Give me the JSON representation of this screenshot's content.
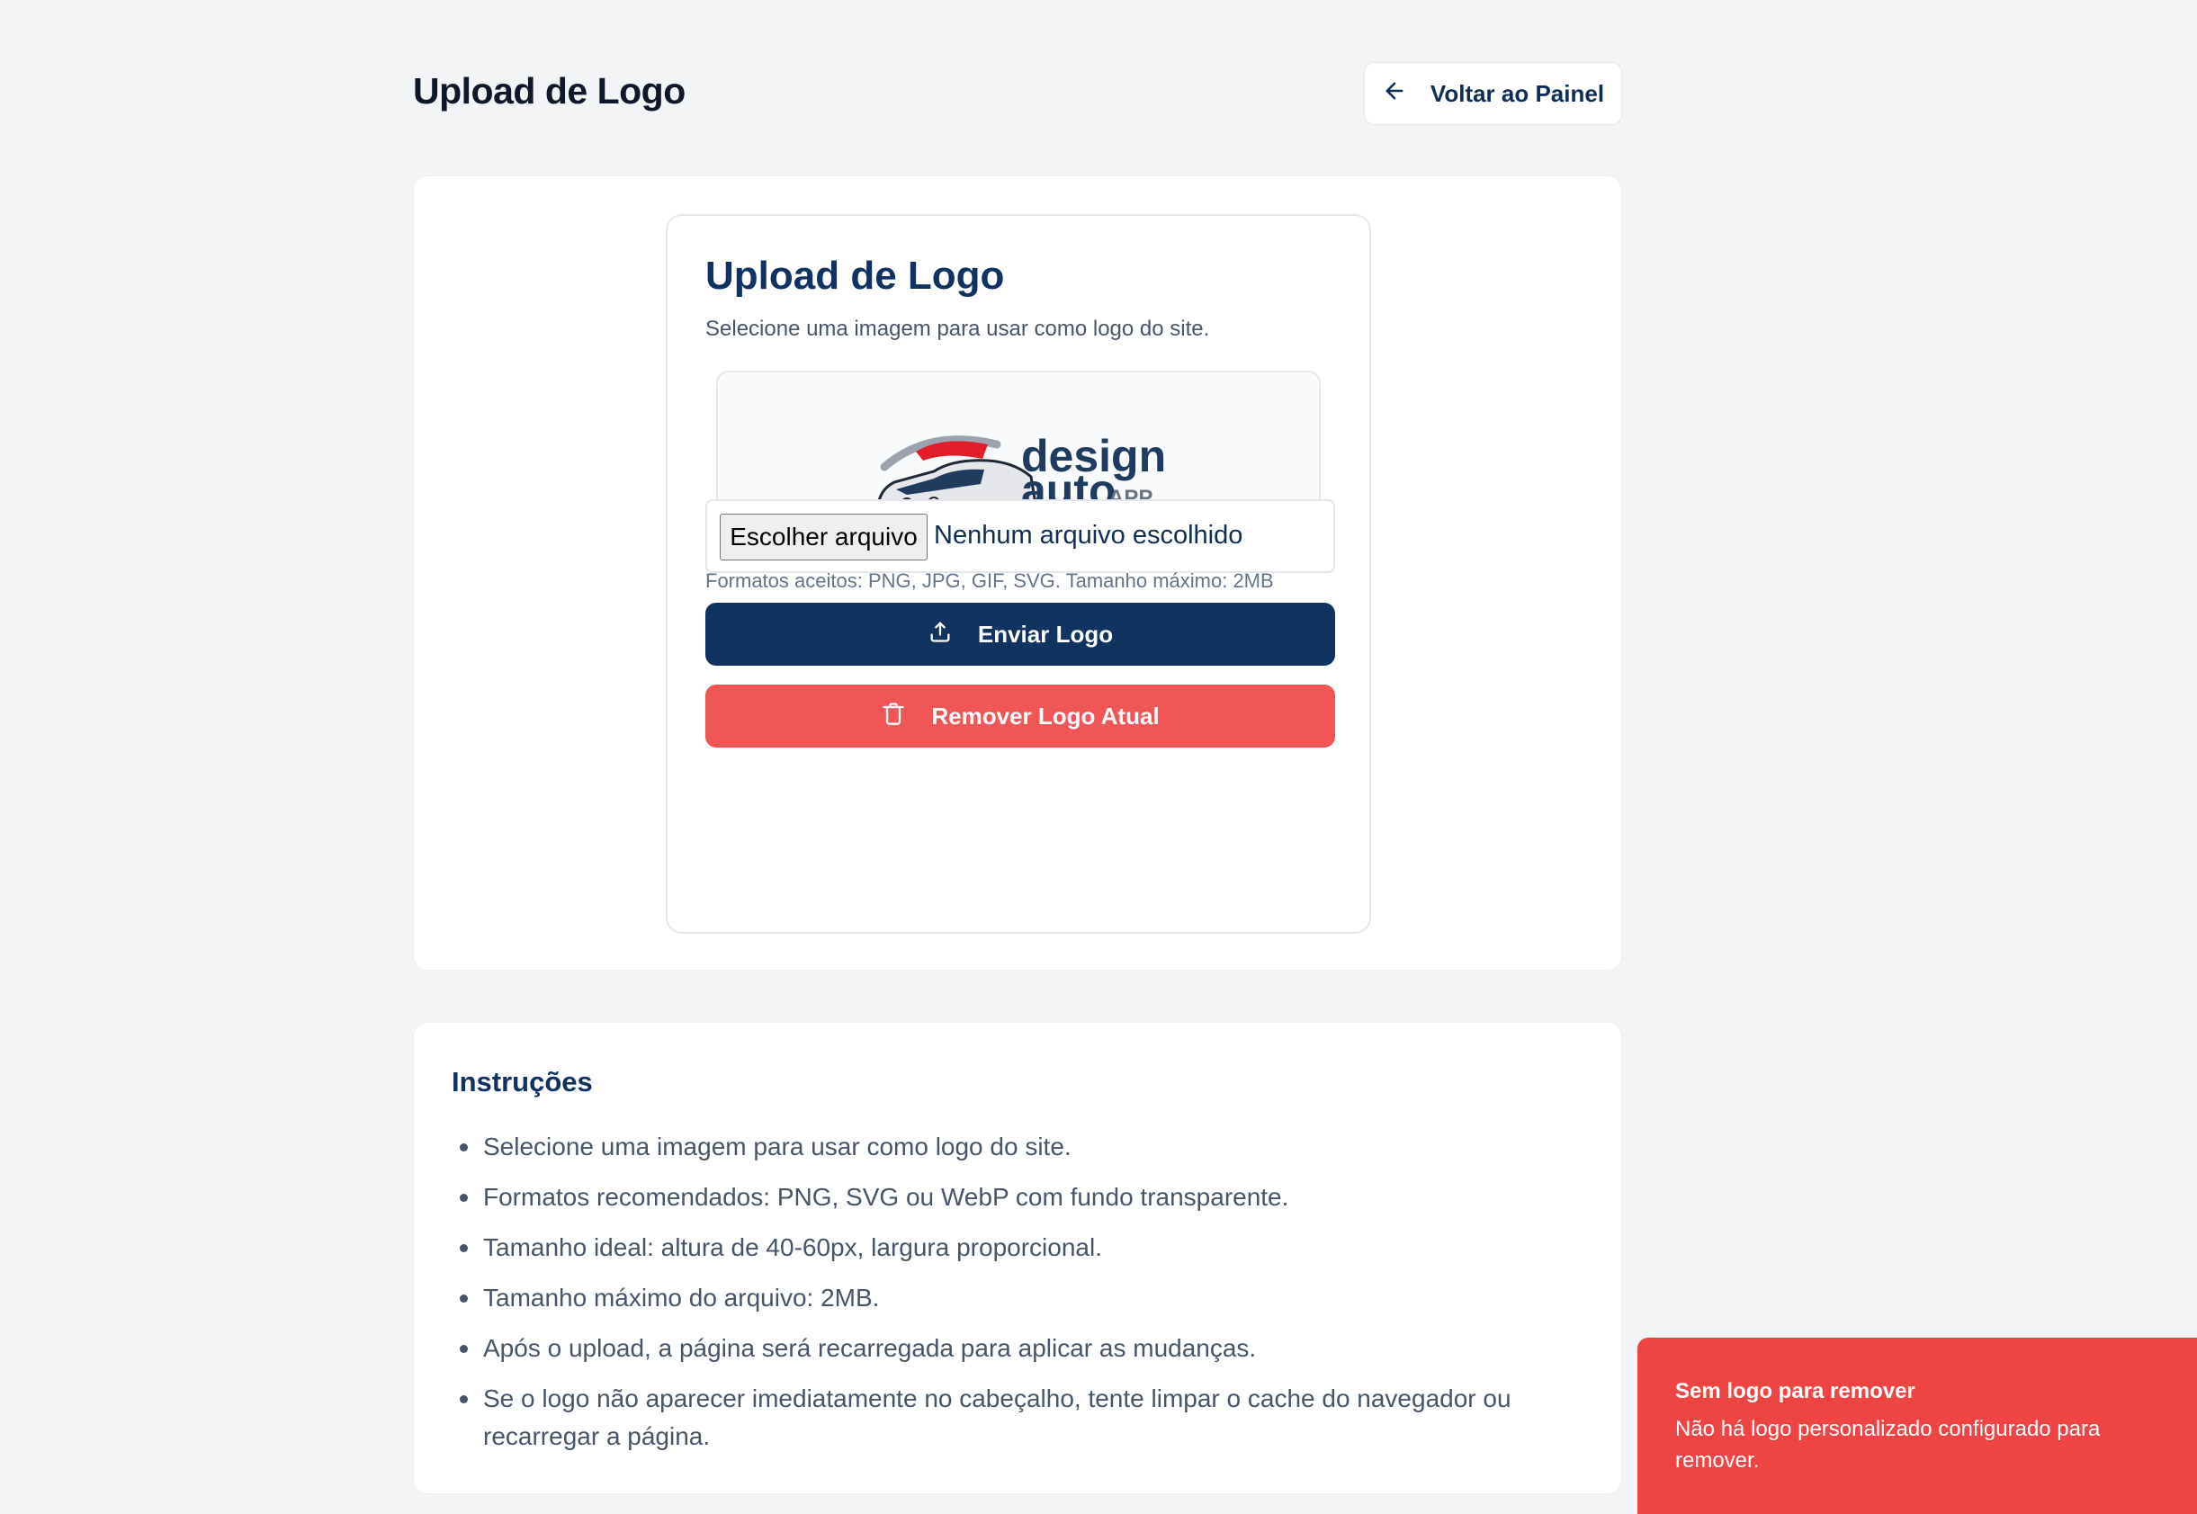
{
  "header": {
    "title": "Upload de Logo",
    "back_label": "Voltar ao Painel"
  },
  "upload": {
    "title": "Upload de Logo",
    "subtitle": "Selecione uma imagem para usar como logo do site.",
    "logo_text_top": "design",
    "logo_text_bottom": "auto",
    "logo_text_app": "APP",
    "file_button": "Escolher arquivo",
    "file_status": "Nenhum arquivo escolhido",
    "formats_hint": "Formatos aceitos: PNG, JPG, GIF, SVG. Tamanho máximo: 2MB",
    "send_label": "Enviar Logo",
    "remove_label": "Remover Logo Atual"
  },
  "instructions": {
    "title": "Instruções",
    "items": [
      "Selecione uma imagem para usar como logo do site.",
      "Formatos recomendados: PNG, SVG ou WebP com fundo transparente.",
      "Tamanho ideal: altura de 40-60px, largura proporcional.",
      "Tamanho máximo do arquivo: 2MB.",
      "Após o upload, a página será recarregada para aplicar as mudanças.",
      "Se o logo não aparecer imediatamente no cabeçalho, tente limpar o cache do navegador ou recarregar a página."
    ]
  },
  "toast": {
    "title": "Sem logo para remover",
    "message": "Não há logo personalizado configurado para remover."
  },
  "colors": {
    "primary": "#11335f",
    "danger": "#f05656",
    "toast": "#ef4444",
    "background": "#f3f4f6"
  }
}
